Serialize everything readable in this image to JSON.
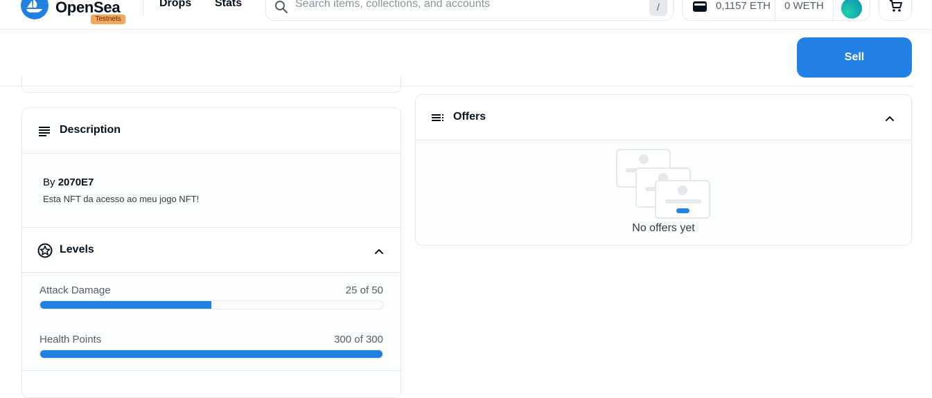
{
  "navbar": {
    "logo_text": "OpenSea",
    "testnet_badge": "Testnets",
    "links": [
      "Drops",
      "Stats"
    ],
    "search_placeholder": "Search items, collections, and accounts",
    "search_shortcut": "/",
    "wallet_eth": "0,1157 ETH",
    "wallet_weth": "0 WETH",
    "icons": [
      "opensea-logo-icon",
      "search-icon",
      "wallet-icon",
      "cart-icon"
    ]
  },
  "actions": {
    "sell_label": "Sell",
    "accent_color": "#2081e2"
  },
  "description": {
    "title": "Description",
    "by_prefix": "By",
    "creator": "2070E7",
    "text": "Esta NFT da acesso ao meu jogo NFT!"
  },
  "levels": {
    "title": "Levels",
    "items": [
      {
        "label": "Attack Damage",
        "value_text": "25 of 50",
        "value": 25,
        "max": 50
      },
      {
        "label": "Health Points",
        "value_text": "300 of 300",
        "value": 300,
        "max": 300
      }
    ]
  },
  "offers": {
    "title": "Offers",
    "empty_text": "No offers yet"
  }
}
